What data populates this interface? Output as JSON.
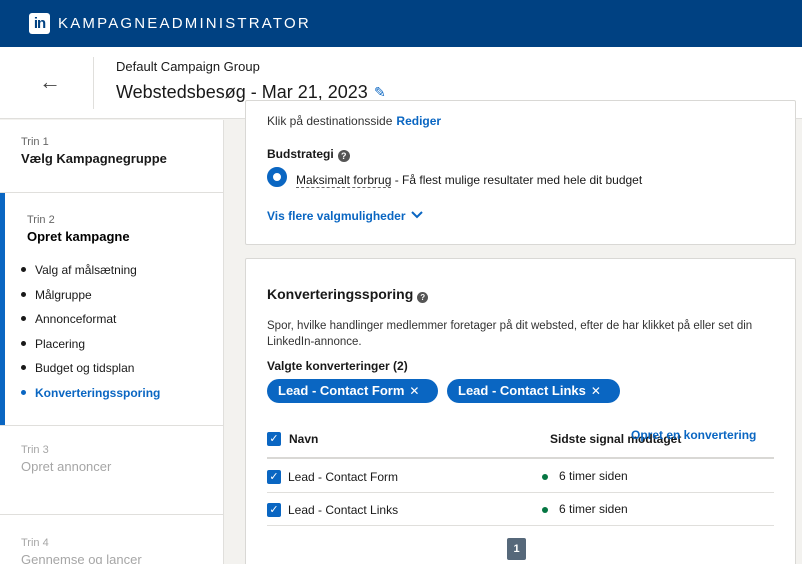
{
  "topbar": {
    "logo": "in",
    "title": "KAMPAGNEADMINISTRATOR"
  },
  "header": {
    "back_icon": "arrow-left-icon",
    "group_name": "Default Campaign Group",
    "campaign_name": "Webstedsbesøg - Mar 21, 2023",
    "edit_icon": "pencil-icon"
  },
  "sidebar": {
    "steps": [
      {
        "num": "Trin 1",
        "name": "Vælg Kampagnegruppe"
      },
      {
        "num": "Trin 2",
        "name": "Opret kampagne",
        "items": [
          "Valg af målsætning",
          "Målgruppe",
          "Annonceformat",
          "Placering",
          "Budget og tidsplan",
          "Konverteringssporing"
        ],
        "current_item": "Konverteringssporing"
      },
      {
        "num": "Trin 3",
        "name": "Opret annoncer"
      },
      {
        "num": "Trin 4",
        "name": "Gennemse og lancer"
      }
    ]
  },
  "bidding": {
    "click_text": "Klik på destinationsside",
    "edit_link": "Rediger",
    "strategy_label": "Budstrategi",
    "option_name": "Maksimalt forbrug",
    "option_desc": " - Få flest mulige resultater med hele dit budget",
    "more_options": "Vis flere valgmuligheder",
    "more_icon": "chevron-down-icon"
  },
  "conversion": {
    "title": "Konverteringssporing",
    "description": "Spor, hvilke handlinger medlemmer foretager på dit websted, efter de har klikket på eller set din LinkedIn-annonce.",
    "selected_label": "Valgte konverteringer (2)",
    "chips": [
      "Lead - Contact Form",
      "Lead - Contact Links"
    ],
    "create_link": "Opret en konvertering",
    "table": {
      "col_name": "Navn",
      "col_signal": "Sidste signal modtaget",
      "rows": [
        {
          "name": "Lead - Contact Form",
          "signal": "6 timer siden",
          "checked": true
        },
        {
          "name": "Lead - Contact Links",
          "signal": "6 timer siden",
          "checked": true
        }
      ]
    },
    "page": "1"
  },
  "colors": {
    "brand": "#004182",
    "accent": "#0a66c2",
    "status_green": "#057642"
  }
}
